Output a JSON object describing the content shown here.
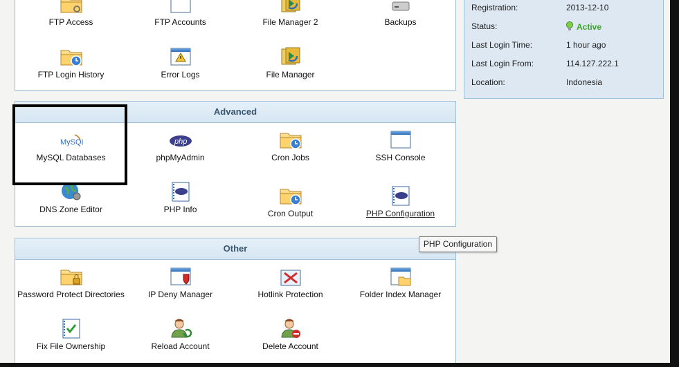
{
  "colors": {
    "panel_border": "#9dbfda",
    "header_text": "#3a5670",
    "active_green": "#3aa32a",
    "info_bg": "#dde8f3"
  },
  "top_panel": {
    "items": [
      {
        "label": "FTP Access",
        "icon": "folder-key-icon"
      },
      {
        "label": "FTP Accounts",
        "icon": "window-icon"
      },
      {
        "label": "File Manager 2",
        "icon": "file-manager-icon"
      },
      {
        "label": "Backups",
        "icon": "backup-drive-icon"
      },
      {
        "label": "FTP Login History",
        "icon": "folder-clock-icon"
      },
      {
        "label": "Error Logs",
        "icon": "warning-log-icon"
      },
      {
        "label": "File Manager",
        "icon": "file-manager-icon"
      }
    ]
  },
  "advanced": {
    "title": "Advanced",
    "items": [
      {
        "label": "MySQL Databases",
        "icon": "mysql-logo-icon"
      },
      {
        "label": "phpMyAdmin",
        "icon": "php-logo-icon"
      },
      {
        "label": "Cron Jobs",
        "icon": "folder-clock-icon"
      },
      {
        "label": "SSH Console",
        "icon": "window-icon"
      },
      {
        "label": "DNS Zone Editor",
        "icon": "globe-gear-icon"
      },
      {
        "label": "PHP Info",
        "icon": "php-notebook-icon"
      },
      {
        "label": "Cron Output",
        "icon": "folder-clock-icon"
      },
      {
        "label": "PHP Configuration",
        "icon": "php-notebook-icon"
      }
    ]
  },
  "other": {
    "title": "Other",
    "items": [
      {
        "label": "Password Protect Directories",
        "icon": "folder-lock-icon"
      },
      {
        "label": "IP Deny Manager",
        "icon": "window-shield-icon"
      },
      {
        "label": "Hotlink Protection",
        "icon": "hotlink-icon"
      },
      {
        "label": "Folder Index Manager",
        "icon": "window-folder-icon"
      },
      {
        "label": "Fix File Ownership",
        "icon": "checklist-icon"
      },
      {
        "label": "Reload Account",
        "icon": "user-reload-icon"
      },
      {
        "label": "Delete Account",
        "icon": "user-delete-icon"
      }
    ]
  },
  "account_info": {
    "rows": [
      {
        "key": "Registration:",
        "value": "2013-12-10"
      },
      {
        "key": "Status:",
        "value": "Active"
      },
      {
        "key": "Last Login Time:",
        "value": "1 hour ago"
      },
      {
        "key": "Last Login From:",
        "value": "114.127.222.1"
      },
      {
        "key": "Location:",
        "value": "Indonesia"
      }
    ]
  },
  "tooltip": {
    "text": "PHP Configuration"
  },
  "mysql_logo_text": "MySQL",
  "php_logo_text": "php"
}
